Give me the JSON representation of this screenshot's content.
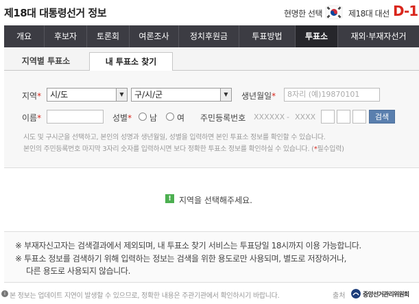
{
  "header": {
    "site_title": "제18대 대통령선거 정보",
    "slogan": "현명한 선택",
    "election_name": "제18대 대선",
    "dday": "D-1"
  },
  "nav": {
    "items": [
      {
        "label": "개요"
      },
      {
        "label": "후보자"
      },
      {
        "label": "토론회"
      },
      {
        "label": "여론조사"
      },
      {
        "label": "정치후원금"
      },
      {
        "label": "투표방법"
      },
      {
        "label": "투표소"
      },
      {
        "label": "재외·부재자선거"
      }
    ],
    "active_index": 6
  },
  "tabs": [
    {
      "label": "지역별 투표소"
    },
    {
      "label": "내 투표소 찾기"
    }
  ],
  "form": {
    "region_label": "지역",
    "sido_value": "시/도",
    "sigungu_value": "구/시/군",
    "birth_label": "생년월일",
    "birth_placeholder": "8자리 (예)19870101",
    "name_label": "이름",
    "gender_label": "성별",
    "gender_options": [
      "남",
      "여"
    ],
    "rrn_label": "주민등록번호",
    "rrn_mask_front": "XXXXXX",
    "rrn_dash": "-",
    "rrn_mask_back": "XXXX",
    "search_button": "검색",
    "required_mark": "*",
    "help_line1": "시도 및 구시군을 선택하고, 본인의 성명과 생년월일, 성별을 입력하면 본인 투표소 정보를 확인할 수 있습니다.",
    "help_line2_prefix": "본인의 주민등록번호 마지막 3자리 숫자를 입력하시면 보다 정확한 투표소 정보를 확인하실 수 있습니다. (",
    "help_line2_suffix": "필수입력)"
  },
  "result": {
    "icon": "!",
    "message": "지역을 선택해주세요."
  },
  "notes": {
    "mark": "※",
    "line1": "부재자신고자는 검색결과에서 제외되며, 내 투표소 찾기 서비스는 투표당일 18시까지 이용 가능합니다.",
    "line2": "투표소 정보를 검색하기 위해 입력하는 정보는 검색을 위한 용도로만 사용되며, 별도로 저장하거나,",
    "line3": "다른 용도로 사용되지 않습니다."
  },
  "footer": {
    "info_icon": "i",
    "text": "본 정보는 업데이트 지연이 발생할 수 있으므로, 정확한 내용은 주관기관에서 확인하시기 바랍니다.",
    "source_label": "출처",
    "source_name": "중앙선거관리위원회"
  },
  "colors": {
    "nav_bg": "#3c3c43",
    "nav_active": "#26262b",
    "accent_red": "#d9261c",
    "search_button": "#5a7fae",
    "result_icon": "#4caf50"
  }
}
